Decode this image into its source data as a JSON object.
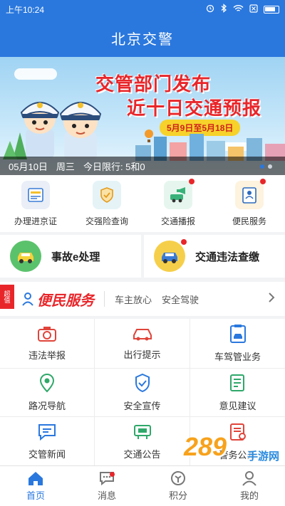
{
  "status_bar": {
    "time": "上午10:24"
  },
  "header": {
    "title": "北京交警"
  },
  "banner": {
    "headline_1": "交管部门发布",
    "headline_2": "近十日交通预报",
    "date_range": "5月9日至5月18日",
    "caption_date": "05月10日",
    "caption_weekday": "周三",
    "caption_limit": "今日限行: 5和0",
    "slide_count": 2,
    "active_slide": 1
  },
  "quick_actions": [
    {
      "label": "办理进京证",
      "icon": "permit-card-icon",
      "badge": false,
      "color": "#e9eef7"
    },
    {
      "label": "交强险查询",
      "icon": "insurance-shield-icon",
      "badge": false,
      "color": "#e5f3f7"
    },
    {
      "label": "交通播报",
      "icon": "broadcast-car-icon",
      "badge": true,
      "color": "#e6f6ee"
    },
    {
      "label": "便民服务",
      "icon": "id-card-icon",
      "badge": true,
      "color": "#fdf3de"
    }
  ],
  "big_actions": [
    {
      "label": "事故e处理",
      "icon": "accident-car-icon",
      "badge": false
    },
    {
      "label": "交通违法查缴",
      "icon": "violation-car-icon",
      "badge": true
    }
  ],
  "service_strip": {
    "ribbon": "超值",
    "logo_text": "便民服务",
    "tags": [
      "车主放心",
      "安全驾驶"
    ]
  },
  "grid": [
    {
      "label": "违法举报",
      "icon": "camera-icon"
    },
    {
      "label": "出行提示",
      "icon": "car-icon"
    },
    {
      "label": "车驾管业务",
      "icon": "clipboard-car-icon"
    },
    {
      "label": "路况导航",
      "icon": "location-pin-icon"
    },
    {
      "label": "安全宣传",
      "icon": "shield-check-icon"
    },
    {
      "label": "意见建议",
      "icon": "note-pen-icon"
    },
    {
      "label": "交管新闻",
      "icon": "chat-news-icon"
    },
    {
      "label": "交通公告",
      "icon": "notice-board-icon"
    },
    {
      "label": "警务公开",
      "icon": "document-person-icon"
    }
  ],
  "tabbar": [
    {
      "label": "首页",
      "icon": "home-icon",
      "active": true,
      "badge": false
    },
    {
      "label": "消息",
      "icon": "message-icon",
      "active": false,
      "badge": true
    },
    {
      "label": "积分",
      "icon": "points-icon",
      "active": false,
      "badge": false
    },
    {
      "label": "我的",
      "icon": "user-icon",
      "active": false,
      "badge": false
    }
  ],
  "watermark": {
    "number": "289",
    "text": "手游网"
  },
  "colors": {
    "brand_blue": "#2a78de",
    "red": "#e8262a",
    "orange": "#f7a21c"
  }
}
